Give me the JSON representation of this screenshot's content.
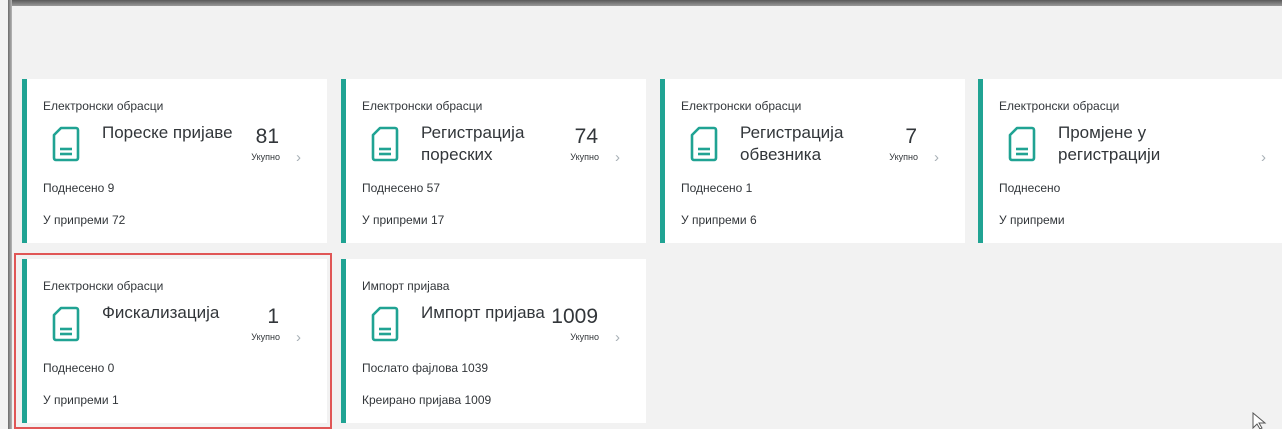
{
  "tiles": [
    {
      "subtitle": "Електронски обрасци",
      "title": "Пореске пријаве",
      "count": "81",
      "unit": "Укупно",
      "stat1": "Поднесено 9",
      "stat2": "У припреми 72"
    },
    {
      "subtitle": "Електронски обрасци",
      "title": "Регистрација пореских",
      "count": "74",
      "unit": "Укупно",
      "stat1": "Поднесено 57",
      "stat2": "У припреми 17"
    },
    {
      "subtitle": "Електронски обрасци",
      "title": "Регистрација обвезника",
      "count": "7",
      "unit": "Укупно",
      "stat1": "Поднесено 1",
      "stat2": "У припреми 6"
    },
    {
      "subtitle": "Електронски обрасци",
      "title": "Промјене у регистрацији",
      "count": "",
      "unit": "",
      "stat1": "Поднесено",
      "stat2": "У припреми"
    },
    {
      "subtitle": "Електронски обрасци",
      "title": "Фискализација",
      "count": "1",
      "unit": "Укупно",
      "stat1": "Поднесено 0",
      "stat2": "У припреми 1"
    },
    {
      "subtitle": "Импорт пријава",
      "title": "Импорт пријава",
      "count": "1009",
      "unit": "Укупно",
      "stat1": "Послато фајлова 1039",
      "stat2": "Креирано пријава 1009"
    }
  ],
  "icons": {
    "tile_icon": "document-icon",
    "nav_icon": "chevron-right-icon"
  },
  "colors": {
    "accent": "#20a393",
    "highlight": "#e05656"
  }
}
